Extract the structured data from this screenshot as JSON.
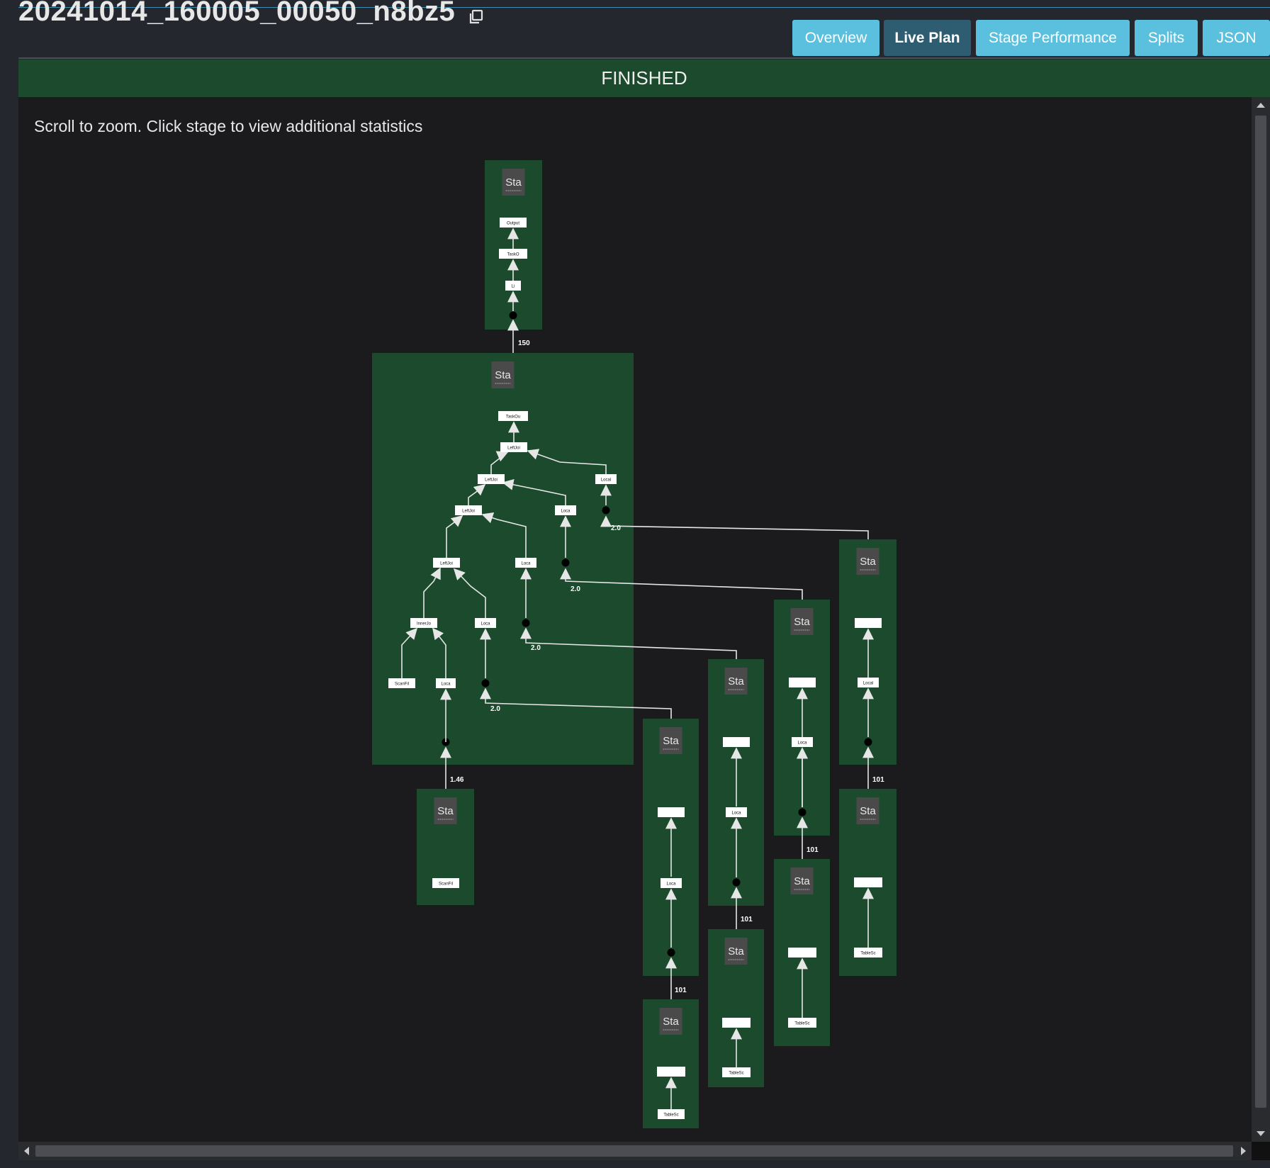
{
  "query": {
    "id": "20241014_160005_00050_n8bz5",
    "state": "FINISHED"
  },
  "icons": {
    "copy": "copy-icon"
  },
  "tabs": [
    {
      "label": "Overview",
      "active": false
    },
    {
      "label": "Live Plan",
      "active": true
    },
    {
      "label": "Stage Performance",
      "active": false
    },
    {
      "label": "Splits",
      "active": false
    },
    {
      "label": "JSON",
      "active": false
    }
  ],
  "plan": {
    "hint": "Scroll to zoom. Click stage to view additional statistics",
    "stage_title": "Sta",
    "stage_title_narrow": "Sta",
    "colors": {
      "stage_bg": "#1b4a2d",
      "stage_header": "#4a4a4a",
      "node_bg": "#ffffff",
      "edge": "#e6e6e6",
      "exchange_dot": "#000000"
    },
    "node_labels": {
      "output": "Output",
      "taskoutput": "TaskO",
      "limit": "Li",
      "taskout_root": "TaskOu",
      "leftjoin": "LeftJoi",
      "local": "Local",
      "loca": "Loca",
      "innerjoin": "InnerJo",
      "scanfilter": "ScanFil",
      "tablescan": "TableSc",
      "blank": ""
    },
    "edge_labels": {
      "e150": "150",
      "e200": "2.0",
      "e146": "1.46",
      "e101": "101"
    }
  }
}
